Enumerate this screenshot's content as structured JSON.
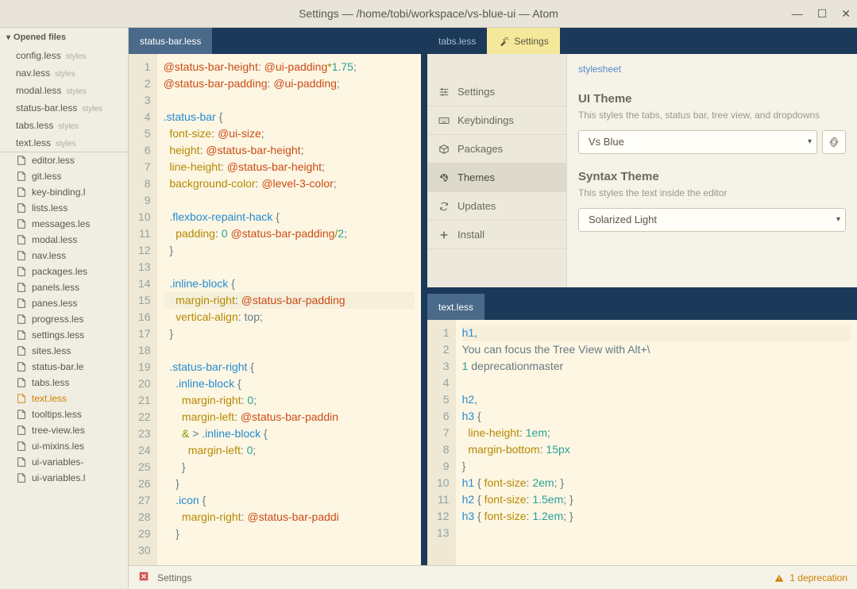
{
  "title": "Settings — /home/tobi/workspace/vs-blue-ui — Atom",
  "opened_header": "Opened files",
  "opened_files": [
    {
      "name": "config.less",
      "dir": "styles"
    },
    {
      "name": "nav.less",
      "dir": "styles"
    },
    {
      "name": "modal.less",
      "dir": "styles"
    },
    {
      "name": "status-bar.less",
      "dir": "styles"
    },
    {
      "name": "tabs.less",
      "dir": "styles"
    },
    {
      "name": "text.less",
      "dir": "styles"
    }
  ],
  "tree_files": [
    {
      "name": "editor.less",
      "active": false
    },
    {
      "name": "git.less",
      "active": false
    },
    {
      "name": "key-binding.l",
      "active": false
    },
    {
      "name": "lists.less",
      "active": false
    },
    {
      "name": "messages.les",
      "active": false
    },
    {
      "name": "modal.less",
      "active": false
    },
    {
      "name": "nav.less",
      "active": false
    },
    {
      "name": "packages.les",
      "active": false
    },
    {
      "name": "panels.less",
      "active": false
    },
    {
      "name": "panes.less",
      "active": false
    },
    {
      "name": "progress.les",
      "active": false
    },
    {
      "name": "settings.less",
      "active": false
    },
    {
      "name": "sites.less",
      "active": false
    },
    {
      "name": "status-bar.le",
      "active": false
    },
    {
      "name": "tabs.less",
      "active": false
    },
    {
      "name": "text.less",
      "active": true
    },
    {
      "name": "tooltips.less",
      "active": false
    },
    {
      "name": "tree-view.les",
      "active": false
    },
    {
      "name": "ui-mixins.les",
      "active": false
    },
    {
      "name": "ui-variables-",
      "active": false
    },
    {
      "name": "ui-variables.l",
      "active": false
    }
  ],
  "left_tab": "status-bar.less",
  "editor1_lines": 30,
  "right_tabs": {
    "tabs": "tabs.less",
    "settings": "Settings"
  },
  "text_tab": "text.less",
  "settings_nav": {
    "settings": "Settings",
    "keybindings": "Keybindings",
    "packages": "Packages",
    "themes": "Themes",
    "updates": "Updates",
    "install": "Install"
  },
  "settings_body": {
    "stylesheet_link": "stylesheet",
    "ui_theme_title": "UI Theme",
    "ui_theme_desc": "This styles the tabs, status bar, tree view, and dropdowns",
    "ui_theme_value": "Vs Blue",
    "syntax_theme_title": "Syntax Theme",
    "syntax_theme_desc": "This styles the text inside the editor",
    "syntax_theme_value": "Solarized Light"
  },
  "editor1_code": [
    [
      {
        "t": "@status-bar-height",
        "c": "c-var"
      },
      {
        "t": ": ",
        "c": ""
      },
      {
        "t": "@ui-padding",
        "c": "c-var"
      },
      {
        "t": "*",
        "c": "c-op"
      },
      {
        "t": "1.75",
        "c": "c-num"
      },
      {
        "t": ";",
        "c": ""
      }
    ],
    [
      {
        "t": "@status-bar-padding",
        "c": "c-var"
      },
      {
        "t": ": ",
        "c": ""
      },
      {
        "t": "@ui-padding",
        "c": "c-var"
      },
      {
        "t": ";",
        "c": ""
      }
    ],
    [],
    [
      {
        "t": ".status-bar",
        "c": "c-sel"
      },
      {
        "t": " {",
        "c": ""
      }
    ],
    [
      {
        "t": "  ",
        "c": ""
      },
      {
        "t": "font-size",
        "c": "c-prop"
      },
      {
        "t": ": ",
        "c": ""
      },
      {
        "t": "@ui-size",
        "c": "c-var"
      },
      {
        "t": ";",
        "c": ""
      }
    ],
    [
      {
        "t": "  ",
        "c": ""
      },
      {
        "t": "height",
        "c": "c-prop"
      },
      {
        "t": ": ",
        "c": ""
      },
      {
        "t": "@status-bar-height",
        "c": "c-var"
      },
      {
        "t": ";",
        "c": ""
      }
    ],
    [
      {
        "t": "  ",
        "c": ""
      },
      {
        "t": "line-height",
        "c": "c-prop"
      },
      {
        "t": ": ",
        "c": ""
      },
      {
        "t": "@status-bar-height",
        "c": "c-var"
      },
      {
        "t": ";",
        "c": ""
      }
    ],
    [
      {
        "t": "  ",
        "c": ""
      },
      {
        "t": "background-color",
        "c": "c-prop"
      },
      {
        "t": ": ",
        "c": ""
      },
      {
        "t": "@level-3-color",
        "c": "c-var"
      },
      {
        "t": ";",
        "c": ""
      }
    ],
    [],
    [
      {
        "t": "  ",
        "c": ""
      },
      {
        "t": ".flexbox-repaint-hack",
        "c": "c-sel"
      },
      {
        "t": " {",
        "c": ""
      }
    ],
    [
      {
        "t": "    ",
        "c": ""
      },
      {
        "t": "padding",
        "c": "c-prop"
      },
      {
        "t": ": ",
        "c": ""
      },
      {
        "t": "0",
        "c": "c-num"
      },
      {
        "t": " ",
        "c": ""
      },
      {
        "t": "@status-bar-padding",
        "c": "c-var"
      },
      {
        "t": "/",
        "c": "c-op"
      },
      {
        "t": "2",
        "c": "c-num"
      },
      {
        "t": ";",
        "c": ""
      }
    ],
    [
      {
        "t": "  }",
        "c": ""
      }
    ],
    [],
    [
      {
        "t": "  ",
        "c": ""
      },
      {
        "t": ".inline-block",
        "c": "c-sel"
      },
      {
        "t": " {",
        "c": ""
      }
    ],
    [
      {
        "t": "    ",
        "c": ""
      },
      {
        "t": "margin-right",
        "c": "c-prop"
      },
      {
        "t": ": ",
        "c": ""
      },
      {
        "t": "@status-bar-padding",
        "c": "c-var"
      }
    ],
    [
      {
        "t": "    ",
        "c": ""
      },
      {
        "t": "vertical-align",
        "c": "c-prop"
      },
      {
        "t": ": ",
        "c": ""
      },
      {
        "t": "top",
        "c": ""
      },
      {
        "t": ";",
        "c": ""
      }
    ],
    [
      {
        "t": "  }",
        "c": ""
      }
    ],
    [],
    [
      {
        "t": "  ",
        "c": ""
      },
      {
        "t": ".status-bar-right",
        "c": "c-sel"
      },
      {
        "t": " {",
        "c": ""
      }
    ],
    [
      {
        "t": "    ",
        "c": ""
      },
      {
        "t": ".inline-block",
        "c": "c-sel"
      },
      {
        "t": " {",
        "c": ""
      }
    ],
    [
      {
        "t": "      ",
        "c": ""
      },
      {
        "t": "margin-right",
        "c": "c-prop"
      },
      {
        "t": ": ",
        "c": ""
      },
      {
        "t": "0",
        "c": "c-num"
      },
      {
        "t": ";",
        "c": ""
      }
    ],
    [
      {
        "t": "      ",
        "c": ""
      },
      {
        "t": "margin-left",
        "c": "c-prop"
      },
      {
        "t": ": ",
        "c": ""
      },
      {
        "t": "@status-bar-paddin",
        "c": "c-var"
      }
    ],
    [
      {
        "t": "      ",
        "c": ""
      },
      {
        "t": "&",
        "c": "c-op"
      },
      {
        "t": " > ",
        "c": ""
      },
      {
        "t": ".inline-block",
        "c": "c-sel"
      },
      {
        "t": " {",
        "c": ""
      }
    ],
    [
      {
        "t": "        ",
        "c": ""
      },
      {
        "t": "margin-left",
        "c": "c-prop"
      },
      {
        "t": ": ",
        "c": ""
      },
      {
        "t": "0",
        "c": "c-num"
      },
      {
        "t": ";",
        "c": ""
      }
    ],
    [
      {
        "t": "      }",
        "c": ""
      }
    ],
    [
      {
        "t": "    }",
        "c": ""
      }
    ],
    [
      {
        "t": "    ",
        "c": ""
      },
      {
        "t": ".icon",
        "c": "c-sel"
      },
      {
        "t": " {",
        "c": ""
      }
    ],
    [
      {
        "t": "      ",
        "c": ""
      },
      {
        "t": "margin-right",
        "c": "c-prop"
      },
      {
        "t": ": ",
        "c": ""
      },
      {
        "t": "@status-bar-paddi",
        "c": "c-var"
      }
    ],
    [
      {
        "t": "    }",
        "c": ""
      }
    ]
  ],
  "editor2_lines": 13,
  "editor2_code": [
    [
      {
        "t": "h1",
        "c": "c-sel"
      },
      {
        "t": ",",
        "c": ""
      }
    ],
    [
      {
        "t": "You can focus the Tree View with Alt+\\",
        "c": ""
      }
    ],
    [
      {
        "t": "1",
        "c": "c-num"
      },
      {
        "t": " deprecationmaster",
        "c": ""
      }
    ],
    [],
    [
      {
        "t": "h2",
        "c": "c-sel"
      },
      {
        "t": ",",
        "c": ""
      }
    ],
    [
      {
        "t": "h3",
        "c": "c-sel"
      },
      {
        "t": " {",
        "c": ""
      }
    ],
    [
      {
        "t": "  ",
        "c": ""
      },
      {
        "t": "line-height",
        "c": "c-prop"
      },
      {
        "t": ": ",
        "c": ""
      },
      {
        "t": "1em",
        "c": "c-num"
      },
      {
        "t": ";",
        "c": ""
      }
    ],
    [
      {
        "t": "  ",
        "c": ""
      },
      {
        "t": "margin-bottom",
        "c": "c-prop"
      },
      {
        "t": ": ",
        "c": ""
      },
      {
        "t": "15px",
        "c": "c-num"
      }
    ],
    [
      {
        "t": "}",
        "c": ""
      }
    ],
    [
      {
        "t": "h1",
        "c": "c-sel"
      },
      {
        "t": " { ",
        "c": ""
      },
      {
        "t": "font-size",
        "c": "c-prop"
      },
      {
        "t": ": ",
        "c": ""
      },
      {
        "t": "2em",
        "c": "c-num"
      },
      {
        "t": "; }",
        "c": ""
      }
    ],
    [
      {
        "t": "h2",
        "c": "c-sel"
      },
      {
        "t": " { ",
        "c": ""
      },
      {
        "t": "font-size",
        "c": "c-prop"
      },
      {
        "t": ": ",
        "c": ""
      },
      {
        "t": "1.5em",
        "c": "c-num"
      },
      {
        "t": "; }",
        "c": ""
      }
    ],
    [
      {
        "t": "h3",
        "c": "c-sel"
      },
      {
        "t": " { ",
        "c": ""
      },
      {
        "t": "font-size",
        "c": "c-prop"
      },
      {
        "t": ": ",
        "c": ""
      },
      {
        "t": "1.2em",
        "c": "c-num"
      },
      {
        "t": "; }",
        "c": ""
      }
    ],
    []
  ],
  "status": {
    "settings": "Settings",
    "deprecation": "1 deprecation"
  }
}
